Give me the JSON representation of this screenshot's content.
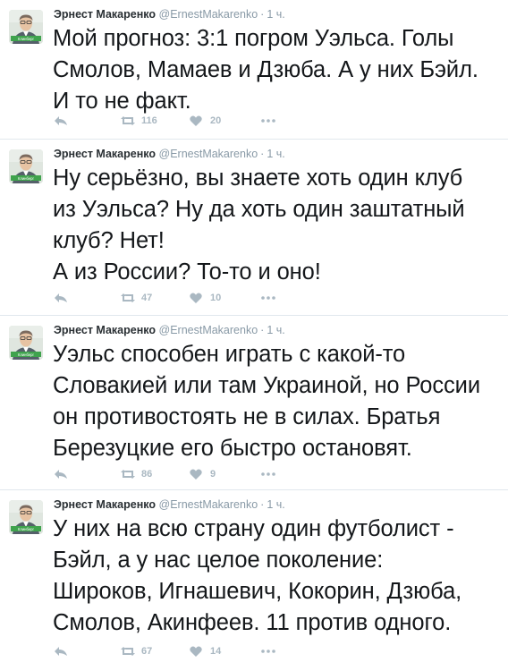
{
  "tweets": [
    {
      "name": "Эрнест Макаренко",
      "handle": "@ErnestMakarenko",
      "separator": "·",
      "time": "1 ч.",
      "text": "Мой прогноз: 3:1 погром Уэльса. Голы\nСмолов, Мамаев и Дзюба. А у них Бэйл.\nИ то не факт.",
      "retweets": "116",
      "likes": "20"
    },
    {
      "name": "Эрнест Макаренко",
      "handle": "@ErnestMakarenko",
      "separator": "·",
      "time": "1 ч.",
      "text": "Ну серьёзно, вы знаете хоть один клуб\nиз Уэльса? Ну да хоть один заштатный\nклуб? Нет!\nА из России? То-то и оно!",
      "retweets": "47",
      "likes": "10"
    },
    {
      "name": "Эрнест Макаренко",
      "handle": "@ErnestMakarenko",
      "separator": "·",
      "time": "1 ч.",
      "text": "Уэльс способен играть с какой-то\nСловакией или там Украиной, но России\nон противостоять не в силах. Братья\nБерезуцкие его быстро остановят.",
      "retweets": "86",
      "likes": "9"
    },
    {
      "name": "Эрнест Макаренко",
      "handle": "@ErnestMakarenko",
      "separator": "·",
      "time": "1 ч.",
      "text": "У них на всю страну один футболист -\nБэйл, а у нас целое поколение:\nШироков, Игнашевич, Кокорин, Дзюба,\nСмолов, Акинфеев. 11 против одного.",
      "retweets": "67",
      "likes": "14"
    }
  ],
  "icons": {
    "reply": "reply-icon",
    "retweet": "retweet-icon",
    "like": "heart-icon",
    "more": "more-icon"
  },
  "avatar_caption": "Клинберг",
  "colors": {
    "name": "#292f33",
    "meta": "#8899a6",
    "action": "#aab8c2",
    "text": "#14171a",
    "divider": "#e1e8ed",
    "avatar_bg": "#dfe6df",
    "avatar_accent": "#3fa34d"
  }
}
